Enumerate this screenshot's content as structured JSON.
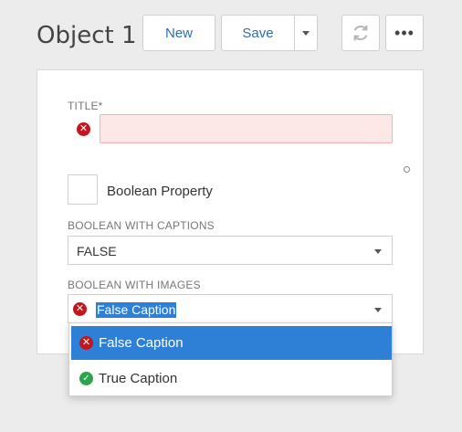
{
  "page": {
    "title": "Object 1"
  },
  "toolbar": {
    "new_label": "New",
    "save_label": "Save",
    "more_label": "•••"
  },
  "form": {
    "title_label": "TITLE*",
    "boolean_property_label": "Boolean Property",
    "captions_label": "BOOLEAN WITH CAPTIONS",
    "captions_value": "FALSE",
    "images_label": "BOOLEAN WITH IMAGES",
    "images_value": "False Caption"
  },
  "dropdown": {
    "options": [
      {
        "label": "False Caption",
        "icon": "error-icon",
        "selected": true
      },
      {
        "label": "True Caption",
        "icon": "check-icon",
        "selected": false
      }
    ]
  },
  "colors": {
    "accent": "#2e7fd6",
    "error": "#c4161c",
    "success": "#2ea44f"
  }
}
